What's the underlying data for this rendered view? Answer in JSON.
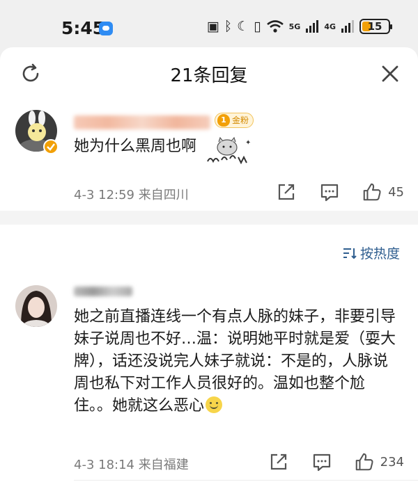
{
  "status": {
    "time": "5:45",
    "signal1": "5G",
    "signal2": "4G",
    "battery": "15"
  },
  "sheet": {
    "title": "21条回复"
  },
  "main_comment": {
    "badge": "金粉",
    "badge_level": "1",
    "text": "她为什么黑周也啊",
    "meta": "4-3 12:59 来自四川",
    "likes": "45"
  },
  "sort": {
    "label": "按热度"
  },
  "reply": {
    "text": "她之前直播连线一个有点人脉的妹子，非要引导妹子说周也不好…温：说明她平时就是爱（耍大牌），话还没说完人妹子就说：不是的，人脉说周也私下对工作人员很好的。温如也整个尬住。。她就这么恶心",
    "meta": "4-3 18:14 来自福建",
    "likes": "234"
  },
  "colors": {
    "accent_link": "#2f5e8f",
    "badge_gold": "#f2a007",
    "meta_gray": "#7a7a7a"
  }
}
